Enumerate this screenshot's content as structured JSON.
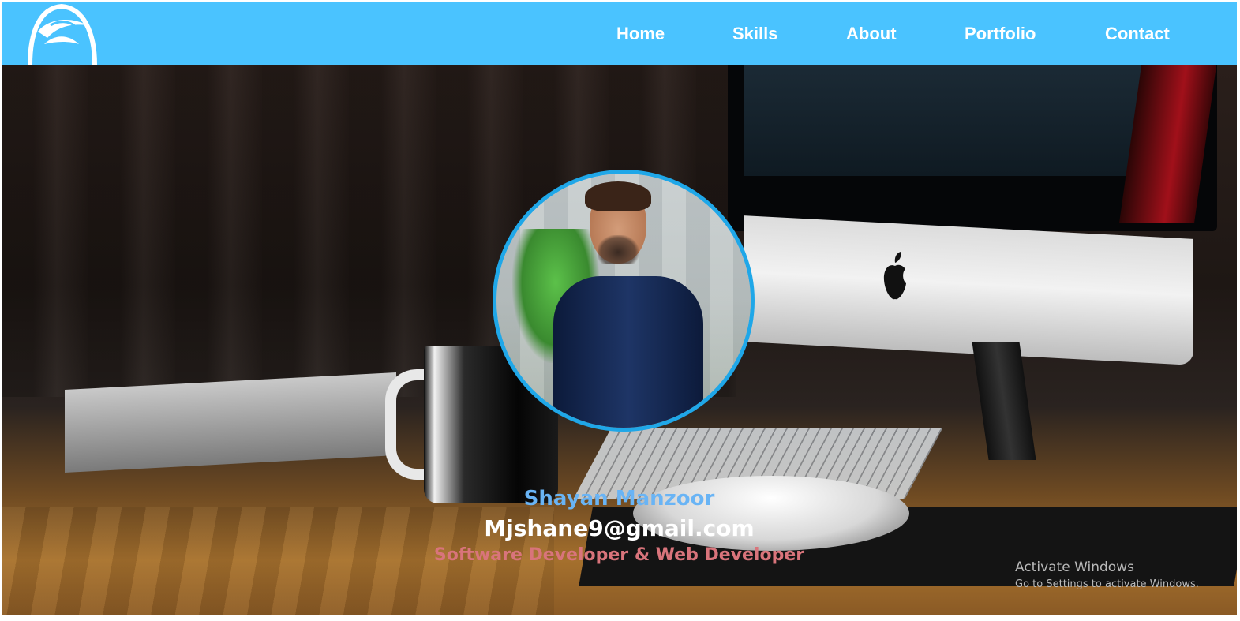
{
  "nav": {
    "links": [
      "Home",
      "Skills",
      "About",
      "Portfolio",
      "Contact"
    ],
    "bg_color": "#4ac3ff"
  },
  "profile": {
    "name": "Shayan Manzoor",
    "email": "Mjshane9@gmail.com",
    "role": "Software Developer & Web Developer",
    "name_color": "#69b4f5",
    "role_color": "#d9747b",
    "avatar_border_color": "#1fa7e8"
  },
  "watermark": {
    "title": "Activate Windows",
    "subtitle": "Go to Settings to activate Windows."
  },
  "icons": {
    "logo": "logo-icon",
    "apple": "apple-logo-icon"
  }
}
